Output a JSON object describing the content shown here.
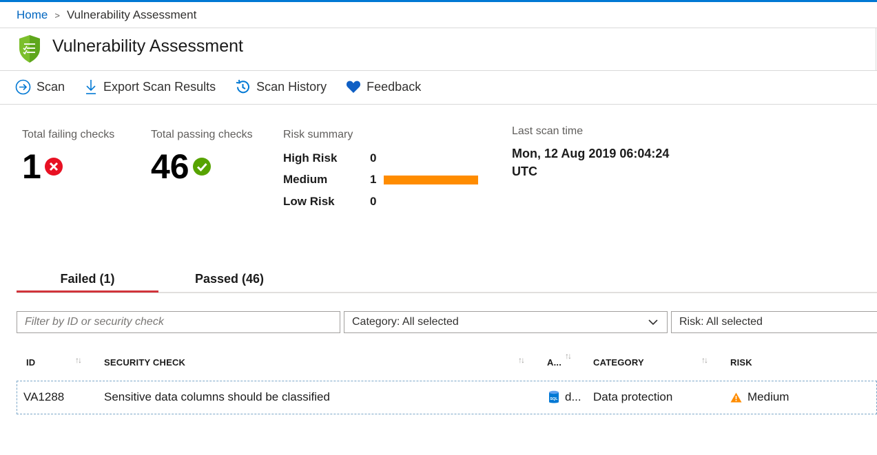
{
  "breadcrumb": {
    "home": "Home",
    "separator": ">",
    "current": "Vulnerability Assessment"
  },
  "page": {
    "title": "Vulnerability Assessment",
    "icon": "shield-check-icon"
  },
  "toolbar": {
    "scan": "Scan",
    "export": "Export Scan Results",
    "history": "Scan History",
    "feedback": "Feedback"
  },
  "stats": {
    "failing_label": "Total failing checks",
    "failing_value": "1",
    "passing_label": "Total passing checks",
    "passing_value": "46"
  },
  "risk_summary": {
    "label": "Risk summary",
    "rows": [
      {
        "name": "High Risk",
        "count": "0",
        "bar_fraction": 0
      },
      {
        "name": "Medium",
        "count": "1",
        "bar_fraction": 1
      },
      {
        "name": "Low Risk",
        "count": "0",
        "bar_fraction": 0
      }
    ]
  },
  "last_scan": {
    "label": "Last scan time",
    "line1": "Mon, 12 Aug 2019 06:04:24",
    "line2": "UTC"
  },
  "tabs": [
    {
      "label": "Failed (1)",
      "active": true
    },
    {
      "label": "Passed (46)",
      "active": false
    }
  ],
  "filters": {
    "search_placeholder": "Filter by ID or security check",
    "category": "Category: All selected",
    "risk": "Risk: All selected"
  },
  "table": {
    "headers": {
      "id": "ID",
      "check": "SECURITY CHECK",
      "applies": "A...",
      "category": "CATEGORY",
      "risk": "RISK"
    },
    "rows": [
      {
        "id": "VA1288",
        "check": "Sensitive data columns should be classified",
        "applies": "d...",
        "category": "Data protection",
        "risk": "Medium"
      }
    ]
  },
  "colors": {
    "accent": "#0078d4",
    "fail": "#e81123",
    "pass": "#57a300",
    "medium_bar": "#ff8c00",
    "active_tab": "#d1343b",
    "warning": "#ff8c00"
  }
}
